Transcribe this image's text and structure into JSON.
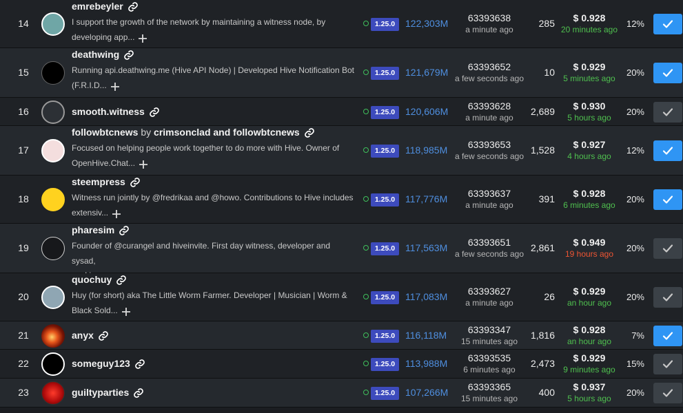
{
  "colors": {
    "approve_on": "#2f95f4",
    "approve_off": "#3b4147",
    "version_badge": "#3d4bbd",
    "votes_text": "#4f8fe0",
    "status_ok": "#3fbf5b",
    "recent_price": "#4fc04f",
    "stale_price": "#ee5533"
  },
  "witnesses": [
    {
      "rank": "14",
      "name": "emrebeyler",
      "by": "",
      "co": "",
      "desc_line1": "I support the growth of the network by maintaining a witness node, by",
      "desc_line2": "developing app...",
      "version": "1.25.0",
      "votes": "122,303M",
      "block": "63393638",
      "block_ago": "a minute ago",
      "missed": "285",
      "price": "$ 0.928",
      "price_ago": "20 minutes ago",
      "price_status": "green",
      "rate": "12%",
      "approved": true,
      "avatar_icon": "pixel-avatar-icon"
    },
    {
      "rank": "15",
      "name": "deathwing",
      "by": "",
      "co": "",
      "desc_line1": "Running api.deathwing.me (Hive API Node) | Developed Hive Notification Bot",
      "desc_line2": "(F.R.I.D...",
      "version": "1.25.0",
      "votes": "121,679M",
      "block": "63393652",
      "block_ago": "a few seconds ago",
      "missed": "10",
      "price": "$ 0.929",
      "price_ago": "5 minutes ago",
      "price_status": "green",
      "rate": "20%",
      "approved": true,
      "avatar_icon": "deathwing-logo-icon"
    },
    {
      "rank": "16",
      "name": "smooth.witness",
      "by": "",
      "co": "",
      "desc_line1": "",
      "desc_line2": "",
      "version": "1.25.0",
      "votes": "120,606M",
      "block": "63393628",
      "block_ago": "a minute ago",
      "missed": "2,689",
      "price": "$ 0.930",
      "price_ago": "5 hours ago",
      "price_status": "green",
      "rate": "20%",
      "approved": false,
      "avatar_icon": "default-user-icon"
    },
    {
      "rank": "17",
      "name": "followbtcnews",
      "by": "by",
      "co": "crimsonclad and followbtcnews",
      "desc_line1": "Focused on helping people work together to do more with Hive. Owner of",
      "desc_line2": "OpenHive.Chat...",
      "version": "1.25.0",
      "votes": "118,985M",
      "block": "63393653",
      "block_ago": "a few seconds ago",
      "missed": "1,528",
      "price": "$ 0.927",
      "price_ago": "4 hours ago",
      "price_status": "green",
      "rate": "12%",
      "approved": true,
      "avatar_icon": "cartoon-avatar-icon"
    },
    {
      "rank": "18",
      "name": "steempress",
      "by": "",
      "co": "",
      "desc_line1": "Witness run jointly by @fredrikaa and @howo. Contributions to Hive includes",
      "desc_line2": "extensiv...",
      "version": "1.25.0",
      "votes": "117,776M",
      "block": "63393637",
      "block_ago": "a minute ago",
      "missed": "391",
      "price": "$ 0.928",
      "price_ago": "6 minutes ago",
      "price_status": "green",
      "rate": "20%",
      "approved": true,
      "avatar_icon": "steempress-logo-icon"
    },
    {
      "rank": "19",
      "name": "pharesim",
      "by": "",
      "co": "",
      "desc_line1": "Founder of @curangel and hiveinvite. First day witness, developer and sysad,",
      "desc_line2": "working...",
      "version": "1.25.0",
      "votes": "117,563M",
      "block": "63393651",
      "block_ago": "a few seconds ago",
      "missed": "2,861",
      "price": "$ 0.949",
      "price_ago": "19 hours ago",
      "price_status": "red",
      "rate": "20%",
      "approved": false,
      "avatar_icon": "blank-avatar-icon"
    },
    {
      "rank": "20",
      "name": "quochuy",
      "by": "",
      "co": "",
      "desc_line1": "Huy (for short) aka The Little Worm Farmer. Developer | Musician | Worm &",
      "desc_line2": "Black Sold...",
      "version": "1.25.0",
      "votes": "117,083M",
      "block": "63393627",
      "block_ago": "a minute ago",
      "missed": "26",
      "price": "$ 0.929",
      "price_ago": "an hour ago",
      "price_status": "green",
      "rate": "20%",
      "approved": false,
      "avatar_icon": "photo-avatar-icon"
    },
    {
      "rank": "21",
      "name": "anyx",
      "by": "",
      "co": "",
      "desc_line1": "",
      "desc_line2": "",
      "version": "1.25.0",
      "votes": "116,118M",
      "block": "63393347",
      "block_ago": "15 minutes ago",
      "missed": "1,816",
      "price": "$ 0.928",
      "price_ago": "an hour ago",
      "price_status": "green",
      "rate": "7%",
      "approved": true,
      "avatar_icon": "fire-avatar-icon"
    },
    {
      "rank": "22",
      "name": "someguy123",
      "by": "",
      "co": "",
      "desc_line1": "",
      "desc_line2": "",
      "version": "1.25.0",
      "votes": "113,988M",
      "block": "63393535",
      "block_ago": "6 minutes ago",
      "missed": "2,473",
      "price": "$ 0.929",
      "price_ago": "9 minutes ago",
      "price_status": "green",
      "rate": "15%",
      "approved": false,
      "avatar_icon": "someguy-logo-icon"
    },
    {
      "rank": "23",
      "name": "guiltyparties",
      "by": "",
      "co": "",
      "desc_line1": "",
      "desc_line2": "",
      "version": "1.25.0",
      "votes": "107,266M",
      "block": "63393365",
      "block_ago": "15 minutes ago",
      "missed": "400",
      "price": "$ 0.937",
      "price_ago": "5 hours ago",
      "price_status": "green",
      "rate": "20%",
      "approved": false,
      "avatar_icon": "red-avatar-icon"
    }
  ]
}
